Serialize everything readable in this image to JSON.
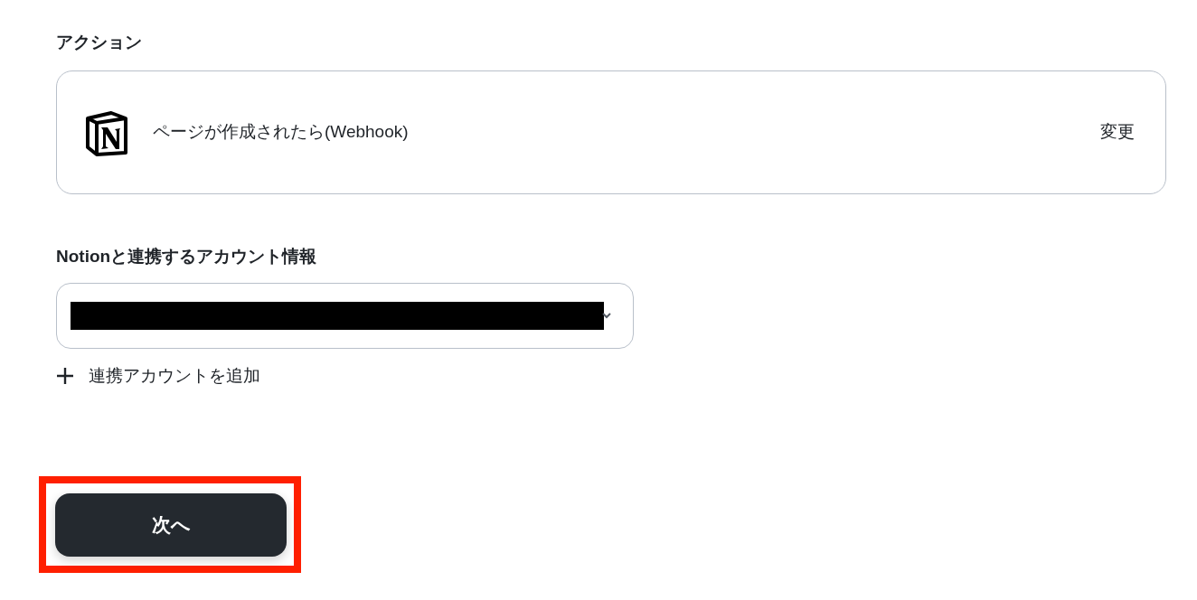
{
  "section_title": "アクション",
  "action": {
    "title": "ページが作成されたら(Webhook)",
    "change_label": "変更"
  },
  "account": {
    "label": "Notionと連携するアカウント情報",
    "value_redacted": true
  },
  "add_account": {
    "label": "連携アカウントを追加"
  },
  "next_button": {
    "label": "次へ",
    "highlighted": true
  }
}
